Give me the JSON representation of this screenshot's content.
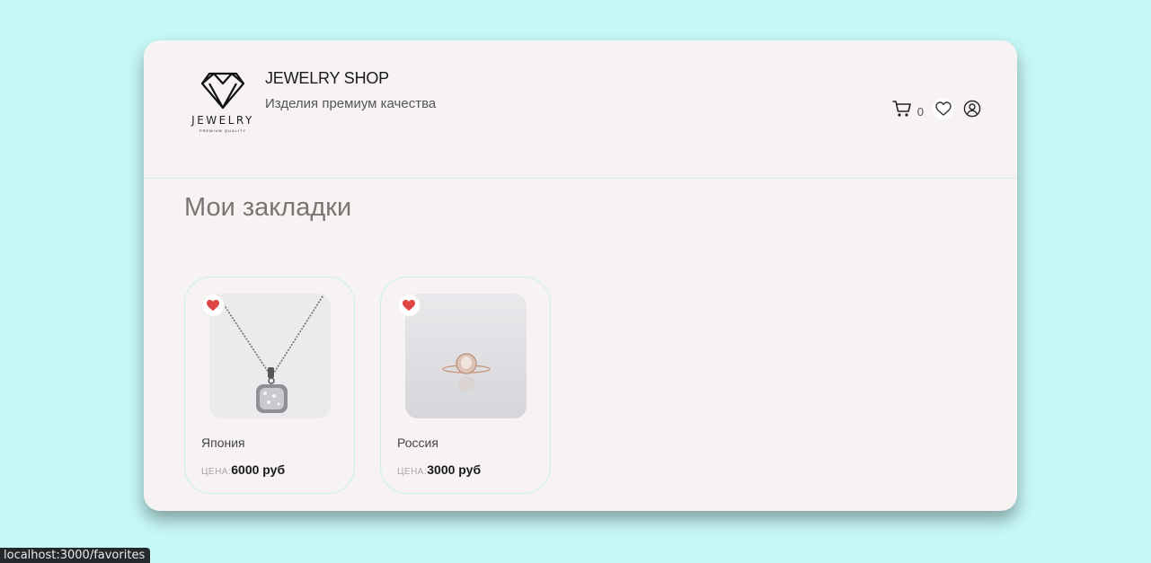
{
  "header": {
    "logo": {
      "word": "JEWELRY",
      "tagline": "PREMIUM QUALITY"
    },
    "title": "JEWELRY SHOP",
    "subtitle": "Изделия премиум качества",
    "cart_count": "0",
    "icons": [
      "cart-icon",
      "heart-icon",
      "user-icon"
    ]
  },
  "main": {
    "title": "Мои закладки",
    "items": [
      {
        "name": "Япония",
        "price_label": "ЦЕНА:",
        "price": "6000 руб",
        "image": "necklace",
        "favorite": true
      },
      {
        "name": "Россия",
        "price_label": "ЦЕНА:",
        "price": "3000 руб",
        "image": "ring",
        "favorite": true
      }
    ]
  },
  "status_bar": {
    "url": "localhost:3000/favorites"
  },
  "colors": {
    "background": "#c6f8f7",
    "panel": "#f6f3f2",
    "heart": "#e04646",
    "card_border": "#c9f0ef"
  }
}
